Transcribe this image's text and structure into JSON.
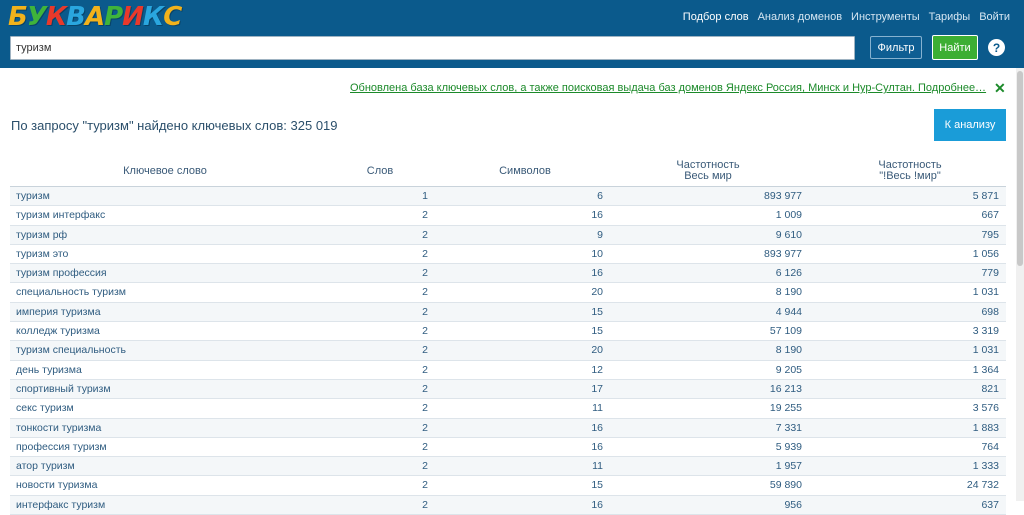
{
  "header": {
    "logo_letters": [
      {
        "ch": "Б",
        "color": "#f2b21b"
      },
      {
        "ch": "У",
        "color": "#3fb43b"
      },
      {
        "ch": "К",
        "color": "#e8392b"
      },
      {
        "ch": "В",
        "color": "#2aa6df"
      },
      {
        "ch": "А",
        "color": "#f2b21b"
      },
      {
        "ch": "Р",
        "color": "#3fb43b"
      },
      {
        "ch": "И",
        "color": "#e8392b"
      },
      {
        "ch": "К",
        "color": "#2aa6df"
      },
      {
        "ch": "С",
        "color": "#f2b21b"
      }
    ],
    "nav": [
      "Подбор слов",
      "Анализ доменов",
      "Инструменты",
      "Тарифы",
      "Войти"
    ],
    "search_value": "туризм",
    "filter_label": "Фильтр",
    "find_label": "Найти",
    "help_label": "?"
  },
  "notice": {
    "text": "Обновлена база ключевых слов, а также поисковая выдача баз доменов Яндекс Россия, Минск и Нур-Султан. Подробнее…",
    "close": "✕"
  },
  "result": {
    "title": "По запросу \"туризм\" найдено ключевых слов: 325 019",
    "analyze_label": "К анализу"
  },
  "table": {
    "headers": {
      "keyword": "Ключевое слово",
      "words": "Слов",
      "chars": "Символов",
      "freq1_line1": "Частотность",
      "freq1_line2": "Весь мир",
      "freq2_line1": "Частотность",
      "freq2_line2": "\"!Весь !мир\""
    },
    "rows": [
      [
        "туризм",
        "1",
        "6",
        "893 977",
        "5 871"
      ],
      [
        "туризм интерфакс",
        "2",
        "16",
        "1 009",
        "667"
      ],
      [
        "туризм рф",
        "2",
        "9",
        "9 610",
        "795"
      ],
      [
        "туризм это",
        "2",
        "10",
        "893 977",
        "1 056"
      ],
      [
        "туризм профессия",
        "2",
        "16",
        "6 126",
        "779"
      ],
      [
        "специальность туризм",
        "2",
        "20",
        "8 190",
        "1 031"
      ],
      [
        "империя туризма",
        "2",
        "15",
        "4 944",
        "698"
      ],
      [
        "колледж туризма",
        "2",
        "15",
        "57 109",
        "3 319"
      ],
      [
        "туризм специальность",
        "2",
        "20",
        "8 190",
        "1 031"
      ],
      [
        "день туризма",
        "2",
        "12",
        "9 205",
        "1 364"
      ],
      [
        "спортивный туризм",
        "2",
        "17",
        "16 213",
        "821"
      ],
      [
        "секс туризм",
        "2",
        "11",
        "19 255",
        "3 576"
      ],
      [
        "тонкости туризма",
        "2",
        "16",
        "7 331",
        "1 883"
      ],
      [
        "профессия туризм",
        "2",
        "16",
        "5 939",
        "764"
      ],
      [
        "атор туризм",
        "2",
        "11",
        "1 957",
        "1 333"
      ],
      [
        "новости туризма",
        "2",
        "15",
        "59 890",
        "24 732"
      ],
      [
        "интерфакс туризм",
        "2",
        "16",
        "956",
        "637"
      ]
    ]
  }
}
